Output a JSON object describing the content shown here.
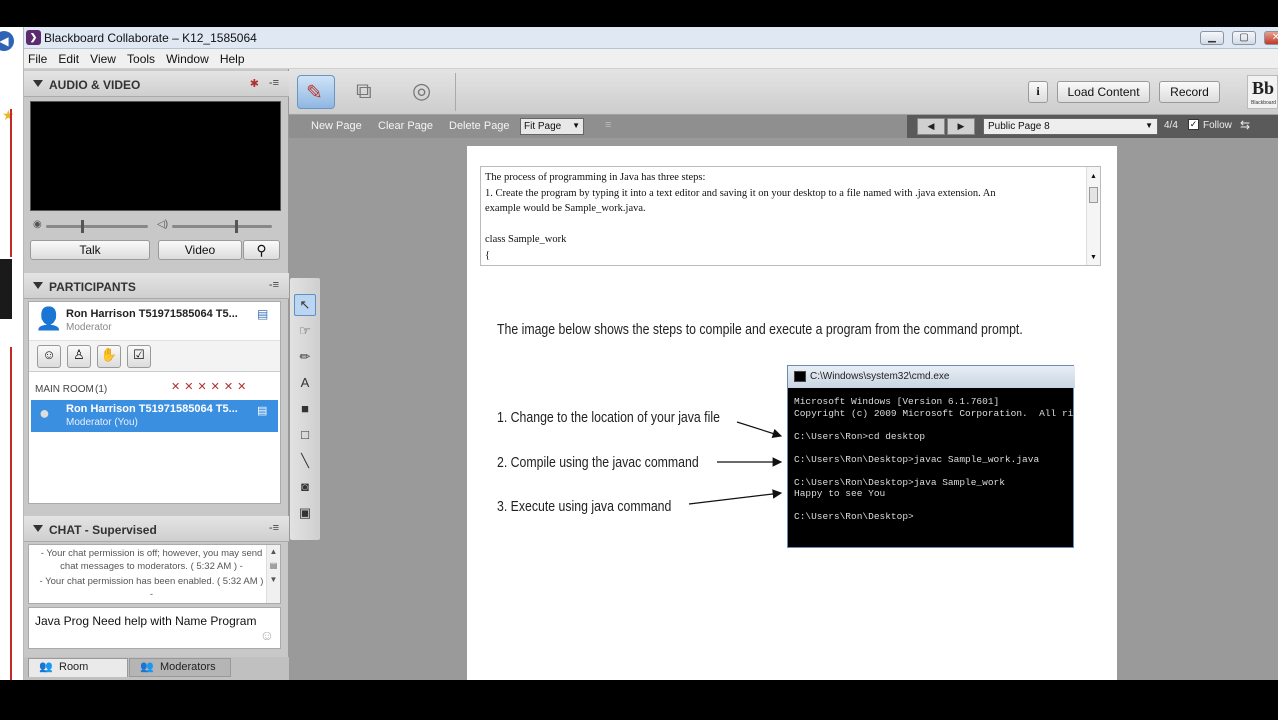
{
  "window": {
    "title": "Blackboard Collaborate – K12_1585064"
  },
  "menu": [
    "File",
    "Edit",
    "View",
    "Tools",
    "Window",
    "Help"
  ],
  "audio_video": {
    "header": "AUDIO & VIDEO",
    "talk_label": "Talk",
    "video_label": "Video"
  },
  "participants": {
    "header": "PARTICIPANTS",
    "current_user": {
      "name": "Ron Harrison T51971585064 T5...",
      "role": "Moderator"
    },
    "room_label": "MAIN ROOM",
    "room_count": "(1)",
    "list": [
      {
        "name": "Ron Harrison T51971585064 T5...",
        "role": "Moderator (You)"
      }
    ]
  },
  "chat": {
    "header": "CHAT - Supervised",
    "messages": [
      "- Your chat permission is off; however, you may send chat messages to moderators. ( 5:32 AM ) -",
      "- Your chat permission has been enabled. ( 5:32 AM ) -"
    ],
    "input_text": "Java Prog Need help with Name Program",
    "tabs": [
      "Room",
      "Moderators"
    ]
  },
  "toolbar": {
    "load_content": "Load Content",
    "record": "Record",
    "logo": "Bb",
    "logo_sub": "Blackboard"
  },
  "page_controls": {
    "new_page": "New Page",
    "clear_page": "Clear Page",
    "delete_page": "Delete Page",
    "zoom": "Fit Page",
    "page_select": "Public Page 8",
    "page_count": "4/4",
    "follow": "Follow"
  },
  "whiteboard": {
    "text_lines": [
      "The process of programming in Java has three steps:",
      "1.  Create the program by typing it into a text editor and saving it on your desktop to a file named with .java extension.  An",
      "example would be Sample_work.java.",
      "",
      "class Sample_work",
      "{"
    ],
    "heading": "The image below shows the steps to compile and execute a program from the command prompt.",
    "steps": [
      "1. Change to the location of your java file",
      "2. Compile using the javac command",
      "3. Execute using java command"
    ],
    "cmd_title": "C:\\Windows\\system32\\cmd.exe",
    "cmd_lines": [
      "Microsoft Windows [Version 6.1.7601]",
      "Copyright (c) 2009 Microsoft Corporation.  All ri",
      "",
      "C:\\Users\\Ron>cd desktop",
      "",
      "C:\\Users\\Ron\\Desktop>javac Sample_work.java",
      "",
      "C:\\Users\\Ron\\Desktop>java Sample_work",
      "Happy to see You",
      "",
      "C:\\Users\\Ron\\Desktop>"
    ]
  },
  "colors": {
    "selection": "#3b8fe0",
    "toolbar_bg": "#d8d8d8",
    "subtoolbar_bg": "#8f8f8f",
    "titlebar": "#dfe8f3"
  }
}
